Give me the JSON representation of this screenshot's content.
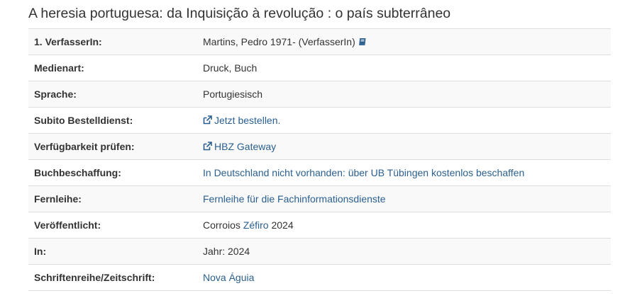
{
  "record": {
    "title": "A heresia portuguesa: da Inquisição à revolução : o país subterrâneo"
  },
  "rows": {
    "author": {
      "label": "1. VerfasserIn:",
      "name": "Martins, Pedro 1971- (VerfasserIn)",
      "icon": "book-icon"
    },
    "medium": {
      "label": "Medienart:",
      "value": "Druck, Buch"
    },
    "language": {
      "label": "Sprache:",
      "value": "Portugiesisch"
    },
    "subito": {
      "label": "Subito Bestelldienst:",
      "link": "Jetzt bestellen.",
      "icon": "external-link-icon"
    },
    "availability": {
      "label": "Verfügbarkeit prüfen:",
      "link": "HBZ Gateway",
      "icon": "external-link-icon"
    },
    "acquisition": {
      "label": "Buchbeschaffung:",
      "link": "In Deutschland nicht vorhanden: über UB Tübingen kostenlos beschaffen"
    },
    "ill": {
      "label": "Fernleihe:",
      "link": "Fernleihe für die Fachinformationsdienste"
    },
    "published": {
      "label": "Veröffentlicht:",
      "place": "Corroios",
      "publisher": "Zéfiro",
      "year": "2024"
    },
    "in": {
      "label": "In:",
      "value": "Jahr: 2024"
    },
    "series": {
      "label": "Schriftenreihe/Zeitschrift:",
      "link": "Nova Águia"
    }
  },
  "colors": {
    "link": "#2a5f8f",
    "text": "#333333",
    "stripe": "#f9f9f9",
    "border": "#dddddd"
  }
}
